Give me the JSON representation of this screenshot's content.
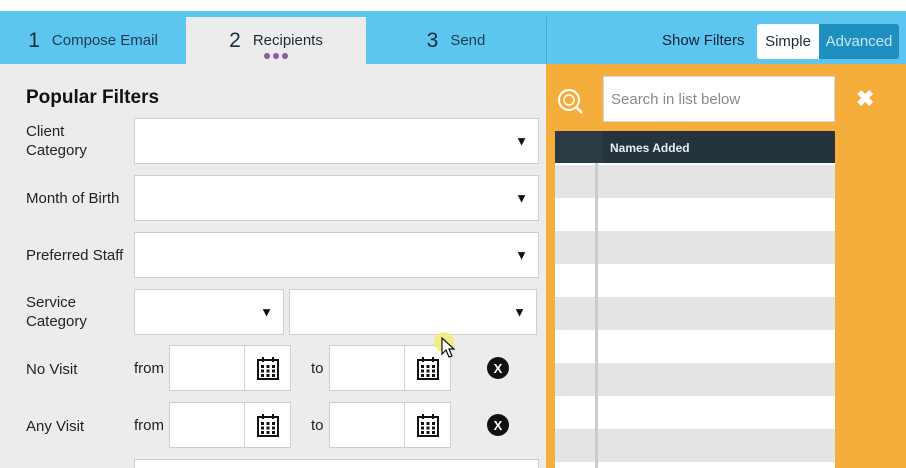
{
  "steps": [
    {
      "num": "1",
      "label": "Compose Email"
    },
    {
      "num": "2",
      "label": "Recipients"
    },
    {
      "num": "3",
      "label": "Send"
    }
  ],
  "filter_toggle": {
    "label": "Show Filters",
    "simple": "Simple",
    "advanced": "Advanced",
    "selected": "Simple"
  },
  "filters": {
    "heading": "Popular Filters",
    "client_category": "Client\nCategory",
    "month_of_birth": "Month of Birth",
    "preferred_staff": "Preferred Staff",
    "service_category": "Service\nCategory",
    "no_visit": "No Visit",
    "any_visit": "Any Visit",
    "from": "from",
    "to": "to",
    "clear": "X"
  },
  "search": {
    "placeholder": "Search in list below",
    "close": "✖"
  },
  "list": {
    "header": "Names Added"
  },
  "colors": {
    "tab_bar": "#5cc6f0",
    "panel": "#f5ad3c",
    "list_header": "#24333c",
    "advanced_btn": "#1f8fc0"
  }
}
